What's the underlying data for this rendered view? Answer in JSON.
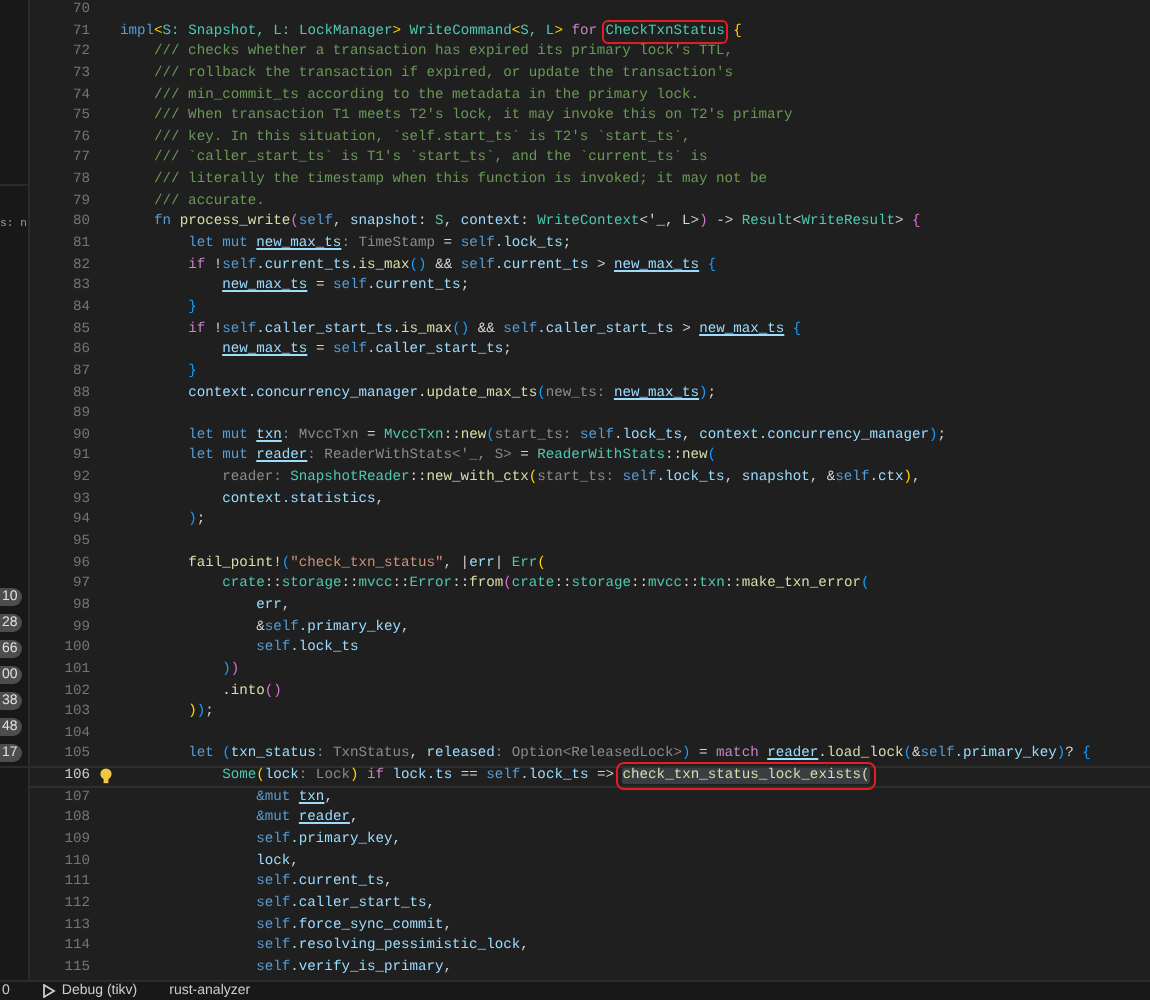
{
  "sidebar": {
    "text": "s: n",
    "badges": [
      "10",
      "28",
      "66",
      "00",
      "38",
      "48",
      "17"
    ]
  },
  "editor": {
    "lines": [
      {
        "number": "70",
        "current": false
      },
      {
        "number": "71",
        "current": false,
        "tokens": [
          {
            "kind": "kw",
            "text": "impl"
          },
          {
            "kind": "b1",
            "text": "<"
          },
          {
            "kind": "type",
            "text": "S: "
          },
          {
            "kind": "type",
            "text": "Snapshot, "
          },
          {
            "kind": "type",
            "text": "L: "
          },
          {
            "kind": "type",
            "text": "LockManager"
          },
          {
            "kind": "b1",
            "text": "> "
          },
          {
            "kind": "type",
            "text": "WriteCommand"
          },
          {
            "kind": "b1",
            "text": "<"
          },
          {
            "kind": "type",
            "text": "S, "
          },
          {
            "kind": "type",
            "text": "L"
          },
          {
            "kind": "b1",
            "text": "> "
          },
          {
            "kind": "ctl",
            "text": "for "
          },
          {
            "kind": "boxed-type",
            "text": "CheckTxnStatus"
          },
          {
            "kind": "b1",
            "text": " {"
          }
        ]
      },
      {
        "number": "72",
        "current": false,
        "tokens": [
          {
            "kind": "comment",
            "text": "    /// checks whether a transaction has expired its primary lock's TTL,"
          }
        ]
      },
      {
        "number": "73",
        "current": false,
        "tokens": [
          {
            "kind": "comment",
            "text": "    /// rollback the transaction if expired, or update the transaction's"
          }
        ]
      },
      {
        "number": "74",
        "current": false,
        "tokens": [
          {
            "kind": "comment",
            "text": "    /// min_commit_ts according to the metadata in the primary lock."
          }
        ]
      },
      {
        "number": "75",
        "current": false,
        "tokens": [
          {
            "kind": "comment",
            "text": "    /// When transaction T1 meets T2's lock, it may invoke this on T2's primary"
          }
        ]
      },
      {
        "number": "76",
        "current": false,
        "tokens": [
          {
            "kind": "comment",
            "text": "    /// key. In this situation, `self.start_ts` is T2's `start_ts`,"
          }
        ]
      },
      {
        "number": "77",
        "current": false,
        "tokens": [
          {
            "kind": "comment",
            "text": "    /// `caller_start_ts` is T1's `start_ts`, and the `current_ts` is"
          }
        ]
      },
      {
        "number": "78",
        "current": false,
        "tokens": [
          {
            "kind": "comment",
            "text": "    /// literally the timestamp when this function is invoked; it may not be"
          }
        ]
      },
      {
        "number": "79",
        "current": false,
        "tokens": [
          {
            "kind": "comment",
            "text": "    /// accurate."
          }
        ]
      },
      {
        "number": "80",
        "current": false,
        "tokens": [
          {
            "kind": "kw",
            "text": "    fn "
          },
          {
            "kind": "fn",
            "text": "process_write"
          },
          {
            "kind": "b2",
            "text": "("
          },
          {
            "kind": "self",
            "text": "self"
          },
          {
            "kind": "p",
            "text": ", "
          },
          {
            "kind": "var",
            "text": "snapshot"
          },
          {
            "kind": "p",
            "text": ": "
          },
          {
            "kind": "type",
            "text": "S"
          },
          {
            "kind": "p",
            "text": ", "
          },
          {
            "kind": "var",
            "text": "context"
          },
          {
            "kind": "p",
            "text": ": "
          },
          {
            "kind": "type",
            "text": "WriteContext"
          },
          {
            "kind": "p",
            "text": "<'_, L>"
          },
          {
            "kind": "b2",
            "text": ")"
          },
          {
            "kind": "p",
            "text": " -> "
          },
          {
            "kind": "type",
            "text": "Result"
          },
          {
            "kind": "p",
            "text": "<"
          },
          {
            "kind": "type",
            "text": "WriteResult"
          },
          {
            "kind": "p",
            "text": "> "
          },
          {
            "kind": "b2",
            "text": "{"
          }
        ]
      },
      {
        "number": "81",
        "current": false,
        "tokens": [
          {
            "kind": "kw",
            "text": "        let mut "
          },
          {
            "kind": "mvar",
            "text": "new_max_ts"
          },
          {
            "kind": "hint",
            "text": ": TimeStamp"
          },
          {
            "kind": "p",
            "text": " = "
          },
          {
            "kind": "self",
            "text": "self"
          },
          {
            "kind": "var",
            "text": ".lock_ts"
          },
          {
            "kind": "p",
            "text": ";"
          }
        ]
      },
      {
        "number": "82",
        "current": false,
        "tokens": [
          {
            "kind": "ctl",
            "text": "        if"
          },
          {
            "kind": "p",
            "text": " !"
          },
          {
            "kind": "self",
            "text": "self"
          },
          {
            "kind": "var",
            "text": ".current_ts"
          },
          {
            "kind": "fn",
            "text": ".is_max"
          },
          {
            "kind": "b3",
            "text": "()"
          },
          {
            "kind": "p",
            "text": " && "
          },
          {
            "kind": "self",
            "text": "self"
          },
          {
            "kind": "var",
            "text": ".current_ts"
          },
          {
            "kind": "p",
            "text": " > "
          },
          {
            "kind": "mvar",
            "text": "new_max_ts"
          },
          {
            "kind": "b3",
            "text": " {"
          }
        ]
      },
      {
        "number": "83",
        "current": false,
        "tokens": [
          {
            "kind": "mvar",
            "text": "            new_max_ts"
          },
          {
            "kind": "p",
            "text": " = "
          },
          {
            "kind": "self",
            "text": "self"
          },
          {
            "kind": "var",
            "text": ".current_ts"
          },
          {
            "kind": "p",
            "text": ";"
          }
        ]
      },
      {
        "number": "84",
        "current": false,
        "tokens": [
          {
            "kind": "b3",
            "text": "        }"
          }
        ]
      },
      {
        "number": "85",
        "current": false,
        "tokens": [
          {
            "kind": "ctl",
            "text": "        if"
          },
          {
            "kind": "p",
            "text": " !"
          },
          {
            "kind": "self",
            "text": "self"
          },
          {
            "kind": "var",
            "text": ".caller_start_ts"
          },
          {
            "kind": "fn",
            "text": ".is_max"
          },
          {
            "kind": "b3",
            "text": "()"
          },
          {
            "kind": "p",
            "text": " && "
          },
          {
            "kind": "self",
            "text": "self"
          },
          {
            "kind": "var",
            "text": ".caller_start_ts"
          },
          {
            "kind": "p",
            "text": " > "
          },
          {
            "kind": "mvar",
            "text": "new_max_ts"
          },
          {
            "kind": "b3",
            "text": " {"
          }
        ]
      },
      {
        "number": "86",
        "current": false,
        "tokens": [
          {
            "kind": "mvar",
            "text": "            new_max_ts"
          },
          {
            "kind": "p",
            "text": " = "
          },
          {
            "kind": "self",
            "text": "self"
          },
          {
            "kind": "var",
            "text": ".caller_start_ts"
          },
          {
            "kind": "p",
            "text": ";"
          }
        ]
      },
      {
        "number": "87",
        "current": false,
        "tokens": [
          {
            "kind": "b3",
            "text": "        }"
          }
        ]
      },
      {
        "number": "88",
        "current": false,
        "tokens": [
          {
            "kind": "var",
            "text": "        context"
          },
          {
            "kind": "var",
            "text": ".concurrency_manager"
          },
          {
            "kind": "fn",
            "text": ".update_max_ts"
          },
          {
            "kind": "b3",
            "text": "("
          },
          {
            "kind": "hint",
            "text": "new_ts: "
          },
          {
            "kind": "mvar",
            "text": "new_max_ts"
          },
          {
            "kind": "b3",
            "text": ")"
          },
          {
            "kind": "p",
            "text": ";"
          }
        ]
      },
      {
        "number": "89",
        "current": false
      },
      {
        "number": "90",
        "current": false,
        "tokens": [
          {
            "kind": "kw",
            "text": "        let mut "
          },
          {
            "kind": "mvar",
            "text": "txn"
          },
          {
            "kind": "hint",
            "text": ": MvccTxn"
          },
          {
            "kind": "p",
            "text": " = "
          },
          {
            "kind": "type",
            "text": "MvccTxn"
          },
          {
            "kind": "p",
            "text": "::"
          },
          {
            "kind": "fn",
            "text": "new"
          },
          {
            "kind": "b3",
            "text": "("
          },
          {
            "kind": "hint",
            "text": "start_ts: "
          },
          {
            "kind": "self",
            "text": "self"
          },
          {
            "kind": "var",
            "text": ".lock_ts"
          },
          {
            "kind": "p",
            "text": ", "
          },
          {
            "kind": "var",
            "text": "context"
          },
          {
            "kind": "var",
            "text": ".concurrency_manager"
          },
          {
            "kind": "b3",
            "text": ")"
          },
          {
            "kind": "p",
            "text": ";"
          }
        ]
      },
      {
        "number": "91",
        "current": false,
        "tokens": [
          {
            "kind": "kw",
            "text": "        let mut "
          },
          {
            "kind": "mvar",
            "text": "reader"
          },
          {
            "kind": "hint",
            "text": ": ReaderWithStats<'_, S>"
          },
          {
            "kind": "p",
            "text": " = "
          },
          {
            "kind": "type",
            "text": "ReaderWithStats"
          },
          {
            "kind": "p",
            "text": "::"
          },
          {
            "kind": "fn",
            "text": "new"
          },
          {
            "kind": "b3",
            "text": "("
          }
        ]
      },
      {
        "number": "92",
        "current": false,
        "tokens": [
          {
            "kind": "hint",
            "text": "            reader: "
          },
          {
            "kind": "type",
            "text": "SnapshotReader"
          },
          {
            "kind": "p",
            "text": "::"
          },
          {
            "kind": "fn",
            "text": "new_with_ctx"
          },
          {
            "kind": "b1",
            "text": "("
          },
          {
            "kind": "hint",
            "text": "start_ts: "
          },
          {
            "kind": "self",
            "text": "self"
          },
          {
            "kind": "var",
            "text": ".lock_ts"
          },
          {
            "kind": "p",
            "text": ", "
          },
          {
            "kind": "var",
            "text": "snapshot"
          },
          {
            "kind": "p",
            "text": ", &"
          },
          {
            "kind": "self",
            "text": "self"
          },
          {
            "kind": "var",
            "text": ".ctx"
          },
          {
            "kind": "b1",
            "text": ")"
          },
          {
            "kind": "p",
            "text": ","
          }
        ]
      },
      {
        "number": "93",
        "current": false,
        "tokens": [
          {
            "kind": "var",
            "text": "            context"
          },
          {
            "kind": "var",
            "text": ".statistics"
          },
          {
            "kind": "p",
            "text": ","
          }
        ]
      },
      {
        "number": "94",
        "current": false,
        "tokens": [
          {
            "kind": "b3",
            "text": "        )"
          },
          {
            "kind": "p",
            "text": ";"
          }
        ]
      },
      {
        "number": "95",
        "current": false
      },
      {
        "number": "96",
        "current": false,
        "tokens": [
          {
            "kind": "fn",
            "text": "        fail_point!"
          },
          {
            "kind": "b3",
            "text": "("
          },
          {
            "kind": "str",
            "text": "\"check_txn_status\""
          },
          {
            "kind": "p",
            "text": ", |"
          },
          {
            "kind": "var",
            "text": "err"
          },
          {
            "kind": "p",
            "text": "| "
          },
          {
            "kind": "type",
            "text": "Err"
          },
          {
            "kind": "b1",
            "text": "("
          }
        ]
      },
      {
        "number": "97",
        "current": false,
        "tokens": [
          {
            "kind": "module",
            "text": "            crate"
          },
          {
            "kind": "p",
            "text": "::"
          },
          {
            "kind": "module",
            "text": "storage"
          },
          {
            "kind": "p",
            "text": "::"
          },
          {
            "kind": "module",
            "text": "mvcc"
          },
          {
            "kind": "p",
            "text": "::"
          },
          {
            "kind": "type",
            "text": "Error"
          },
          {
            "kind": "p",
            "text": "::"
          },
          {
            "kind": "fn",
            "text": "from"
          },
          {
            "kind": "b2",
            "text": "("
          },
          {
            "kind": "module",
            "text": "crate"
          },
          {
            "kind": "p",
            "text": "::"
          },
          {
            "kind": "module",
            "text": "storage"
          },
          {
            "kind": "p",
            "text": "::"
          },
          {
            "kind": "module",
            "text": "mvcc"
          },
          {
            "kind": "p",
            "text": "::"
          },
          {
            "kind": "module",
            "text": "txn"
          },
          {
            "kind": "p",
            "text": "::"
          },
          {
            "kind": "fn",
            "text": "make_txn_error"
          },
          {
            "kind": "b3",
            "text": "("
          }
        ]
      },
      {
        "number": "98",
        "current": false,
        "tokens": [
          {
            "kind": "var",
            "text": "                err"
          },
          {
            "kind": "p",
            "text": ","
          }
        ]
      },
      {
        "number": "99",
        "current": false,
        "tokens": [
          {
            "kind": "p",
            "text": "                &"
          },
          {
            "kind": "self",
            "text": "self"
          },
          {
            "kind": "var",
            "text": ".primary_key"
          },
          {
            "kind": "p",
            "text": ","
          }
        ]
      },
      {
        "number": "100",
        "current": false,
        "tokens": [
          {
            "kind": "self",
            "text": "                self"
          },
          {
            "kind": "var",
            "text": ".lock_ts"
          }
        ]
      },
      {
        "number": "101",
        "current": false,
        "tokens": [
          {
            "kind": "b3",
            "text": "            )"
          },
          {
            "kind": "b2",
            "text": ")"
          }
        ]
      },
      {
        "number": "102",
        "current": false,
        "tokens": [
          {
            "kind": "fn",
            "text": "            .into"
          },
          {
            "kind": "b2",
            "text": "()"
          }
        ]
      },
      {
        "number": "103",
        "current": false,
        "tokens": [
          {
            "kind": "b1",
            "text": "        )"
          },
          {
            "kind": "b3",
            "text": ")"
          },
          {
            "kind": "p",
            "text": ";"
          }
        ]
      },
      {
        "number": "104",
        "current": false
      },
      {
        "number": "105",
        "current": false,
        "tokens": [
          {
            "kind": "kw",
            "text": "        let "
          },
          {
            "kind": "b3",
            "text": "("
          },
          {
            "kind": "var",
            "text": "txn_status"
          },
          {
            "kind": "hint",
            "text": ": TxnStatus"
          },
          {
            "kind": "p",
            "text": ", "
          },
          {
            "kind": "var",
            "text": "released"
          },
          {
            "kind": "hint",
            "text": ": Option<ReleasedLock>"
          },
          {
            "kind": "b3",
            "text": ")"
          },
          {
            "kind": "p",
            "text": " = "
          },
          {
            "kind": "ctl",
            "text": "match "
          },
          {
            "kind": "mvar",
            "text": "reader"
          },
          {
            "kind": "fn",
            "text": ".load_lock"
          },
          {
            "kind": "b3",
            "text": "("
          },
          {
            "kind": "p",
            "text": "&"
          },
          {
            "kind": "self",
            "text": "self"
          },
          {
            "kind": "var",
            "text": ".primary_key"
          },
          {
            "kind": "b3",
            "text": ")"
          },
          {
            "kind": "p",
            "text": "? "
          },
          {
            "kind": "b3",
            "text": "{"
          }
        ]
      },
      {
        "number": "106",
        "current": true,
        "tokens": [
          {
            "kind": "type",
            "text": "            Some"
          },
          {
            "kind": "b1",
            "text": "("
          },
          {
            "kind": "var",
            "text": "lock"
          },
          {
            "kind": "hint",
            "text": ": Lock"
          },
          {
            "kind": "b1",
            "text": ")"
          },
          {
            "kind": "ctl",
            "text": " if "
          },
          {
            "kind": "var",
            "text": "lock"
          },
          {
            "kind": "var",
            "text": ".ts"
          },
          {
            "kind": "p",
            "text": " == "
          },
          {
            "kind": "self",
            "text": "self"
          },
          {
            "kind": "var",
            "text": ".lock_ts"
          },
          {
            "kind": "p",
            "text": " => "
          },
          {
            "kind": "boxed-fn",
            "text": "check_txn_status_lock_exists("
          }
        ]
      },
      {
        "number": "107",
        "current": false,
        "tokens": [
          {
            "kind": "kw",
            "text": "                &mut "
          },
          {
            "kind": "mvar",
            "text": "txn"
          },
          {
            "kind": "p",
            "text": ","
          }
        ]
      },
      {
        "number": "108",
        "current": false,
        "tokens": [
          {
            "kind": "kw",
            "text": "                &mut "
          },
          {
            "kind": "mvar",
            "text": "reader"
          },
          {
            "kind": "p",
            "text": ","
          }
        ]
      },
      {
        "number": "109",
        "current": false,
        "tokens": [
          {
            "kind": "self",
            "text": "                self"
          },
          {
            "kind": "var",
            "text": ".primary_key"
          },
          {
            "kind": "p",
            "text": ","
          }
        ]
      },
      {
        "number": "110",
        "current": false,
        "tokens": [
          {
            "kind": "var",
            "text": "                lock"
          },
          {
            "kind": "p",
            "text": ","
          }
        ]
      },
      {
        "number": "111",
        "current": false,
        "tokens": [
          {
            "kind": "self",
            "text": "                self"
          },
          {
            "kind": "var",
            "text": ".current_ts"
          },
          {
            "kind": "p",
            "text": ","
          }
        ]
      },
      {
        "number": "112",
        "current": false,
        "tokens": [
          {
            "kind": "self",
            "text": "                self"
          },
          {
            "kind": "var",
            "text": ".caller_start_ts"
          },
          {
            "kind": "p",
            "text": ","
          }
        ]
      },
      {
        "number": "113",
        "current": false,
        "tokens": [
          {
            "kind": "self",
            "text": "                self"
          },
          {
            "kind": "var",
            "text": ".force_sync_commit"
          },
          {
            "kind": "p",
            "text": ","
          }
        ]
      },
      {
        "number": "114",
        "current": false,
        "tokens": [
          {
            "kind": "self",
            "text": "                self"
          },
          {
            "kind": "var",
            "text": ".resolving_pessimistic_lock"
          },
          {
            "kind": "p",
            "text": ","
          }
        ]
      },
      {
        "number": "115",
        "current": false,
        "tokens": [
          {
            "kind": "self",
            "text": "                self"
          },
          {
            "kind": "var",
            "text": ".verify_is_primary"
          },
          {
            "kind": "p",
            "text": ","
          }
        ]
      }
    ]
  },
  "status_bar": [
    {
      "kind": "text",
      "text": "0"
    },
    {
      "kind": "debug",
      "text": "Debug (tikv)"
    },
    {
      "kind": "text",
      "text": "rust-analyzer"
    }
  ]
}
